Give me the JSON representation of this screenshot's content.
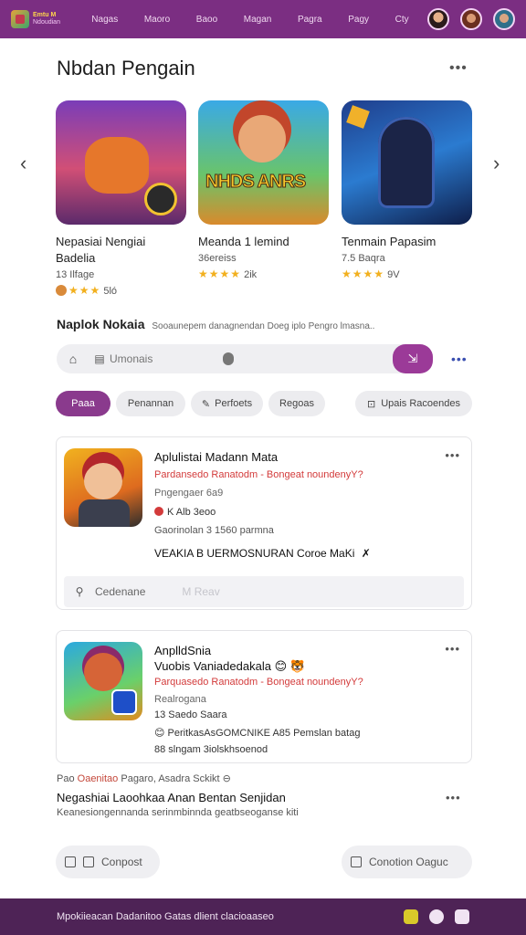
{
  "header": {
    "logo_line1": "Emtu M",
    "logo_line2": "Ndoudian",
    "nav": [
      "Nagas",
      "Maoro",
      "Baoo",
      "Magan",
      "Pagra",
      "Pagy",
      "Cty"
    ]
  },
  "section": {
    "title": "Nbdan Pengain",
    "more": "•••",
    "prev": "‹",
    "next": "›"
  },
  "cards": [
    {
      "title": "Nepasiai Nengiai Badelia",
      "sub": "13 Ilfage",
      "rating": "5ló",
      "stars": "★★★"
    },
    {
      "title": "Meanda 1 lemind",
      "sub": "36ereiss",
      "rating": "2ik",
      "stars": "★★★★",
      "art_text": "NHDS ANRS"
    },
    {
      "title": "Tenmain Papasim",
      "sub": "7.5 Baqra",
      "rating": "9V",
      "stars": "★★★★"
    }
  ],
  "headline": {
    "bold": "Naplok Nokaia",
    "rest": "Sooaunepem danagnendan Doeg iplo Pengro lmasna.."
  },
  "search": {
    "home_icon": "⌂",
    "doc_icon": "▤",
    "placeholder": "Umonais",
    "go_icon": "⇲",
    "more": "•••"
  },
  "chips": [
    "Paaa",
    "Penannan",
    "Perfoets",
    "Regoas",
    "Upais Racoendes"
  ],
  "chip_icons": {
    "perfoets": "✎",
    "upais": "⊡"
  },
  "panel1": {
    "title": "Aplulistai Madann Mata",
    "red_line": "Pardansedo Ranatodm - Bongeat noundenyY?",
    "line3": "Pngengaer 6a9",
    "line4": "K Alb 3eoo",
    "line5": "Gaorinolan 3 1560 parmna",
    "line6": "VEAKIA B UERMOSNURAN Coroe MaKi",
    "line6_icon": "✗",
    "more": "•••",
    "bar_pin": "⚲",
    "bar_label": "Cedenane",
    "bar_extra": "M Reav"
  },
  "panel2": {
    "title1": "AnplldSnia",
    "title2": "Vuobis Vaniadedakala",
    "title2_emoji": "😊 🐯",
    "red_line": "Parquasedo Ranatodm - Bongeat noundenyY?",
    "line4": "Realrogana",
    "line5": "13 Saedo Saara",
    "line6_emoji": "😊",
    "line6": "PeritkasAsGOMCNIKE A85 Pemslan batag",
    "line7": "88 slngam 3iolskhsoenod",
    "more": "•••"
  },
  "footer": {
    "line_prefix": "Pao",
    "line_red": "Oaenitao",
    "line_rest": "Pagaro, Asadra Sckikt",
    "line_icon": "⊖",
    "title": "Negashiai Laoohkaa Anan Bentan Senjidan",
    "sub": "Keanesiongennanda serinmbinnda geatbseoganse kiti",
    "more": "•••",
    "btn_left_label": "Conpost",
    "btn_right_label": "Conotion Oaguc"
  },
  "bottombar": {
    "text": "Mpokiieacan Dadanitoo Gatas dlient clacioaaseo"
  }
}
